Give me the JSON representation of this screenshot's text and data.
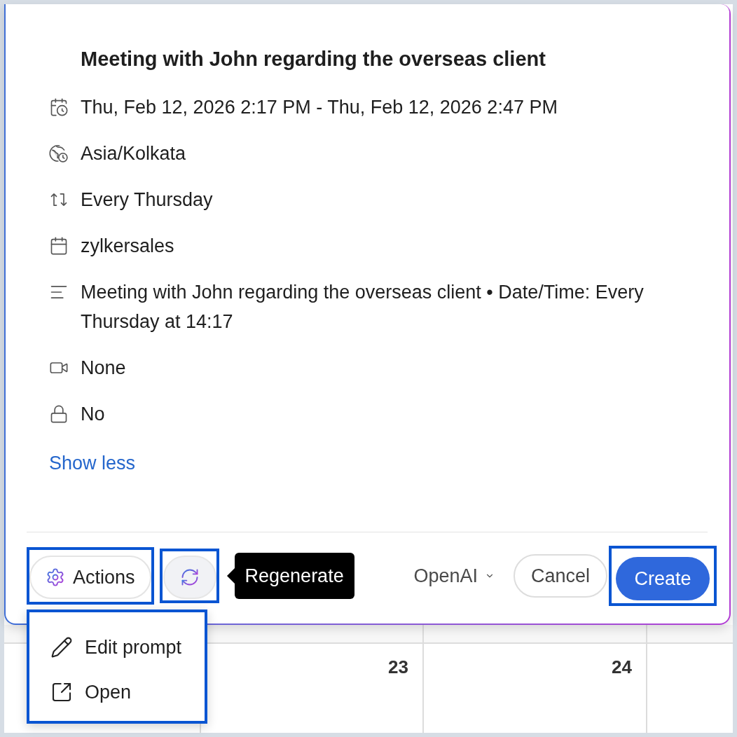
{
  "event": {
    "title": "Meeting with John regarding the overseas client",
    "details": [
      {
        "kind": "datetime",
        "text": "Thu, Feb 12, 2026 2:17 PM - Thu, Feb 12, 2026 2:47 PM"
      },
      {
        "kind": "timezone",
        "text": "Asia/Kolkata"
      },
      {
        "kind": "repeat",
        "text": "Every Thursday"
      },
      {
        "kind": "calendar",
        "text": "zylkersales"
      },
      {
        "kind": "description",
        "text": "Meeting with John regarding the overseas client • Date/Time: Every Thursday at 14:17"
      },
      {
        "kind": "conference",
        "text": "None"
      },
      {
        "kind": "private",
        "text": "No"
      }
    ],
    "toggle_link": "Show less"
  },
  "footer": {
    "actions_button": {
      "label": "Actions",
      "highlighted": true
    },
    "regenerate_button": {
      "highlighted": true,
      "tooltip": "Regenerate"
    },
    "model_select": {
      "value": "OpenAI"
    },
    "cancel_button": {
      "label": "Cancel"
    },
    "create_button": {
      "label": "Create",
      "highlighted": true
    }
  },
  "actions_menu": {
    "highlighted": true,
    "items": [
      {
        "kind": "edit",
        "label": "Edit prompt"
      },
      {
        "kind": "open",
        "label": "Open"
      }
    ]
  },
  "calendar": {
    "day_numbers": [
      "23",
      "24"
    ]
  }
}
